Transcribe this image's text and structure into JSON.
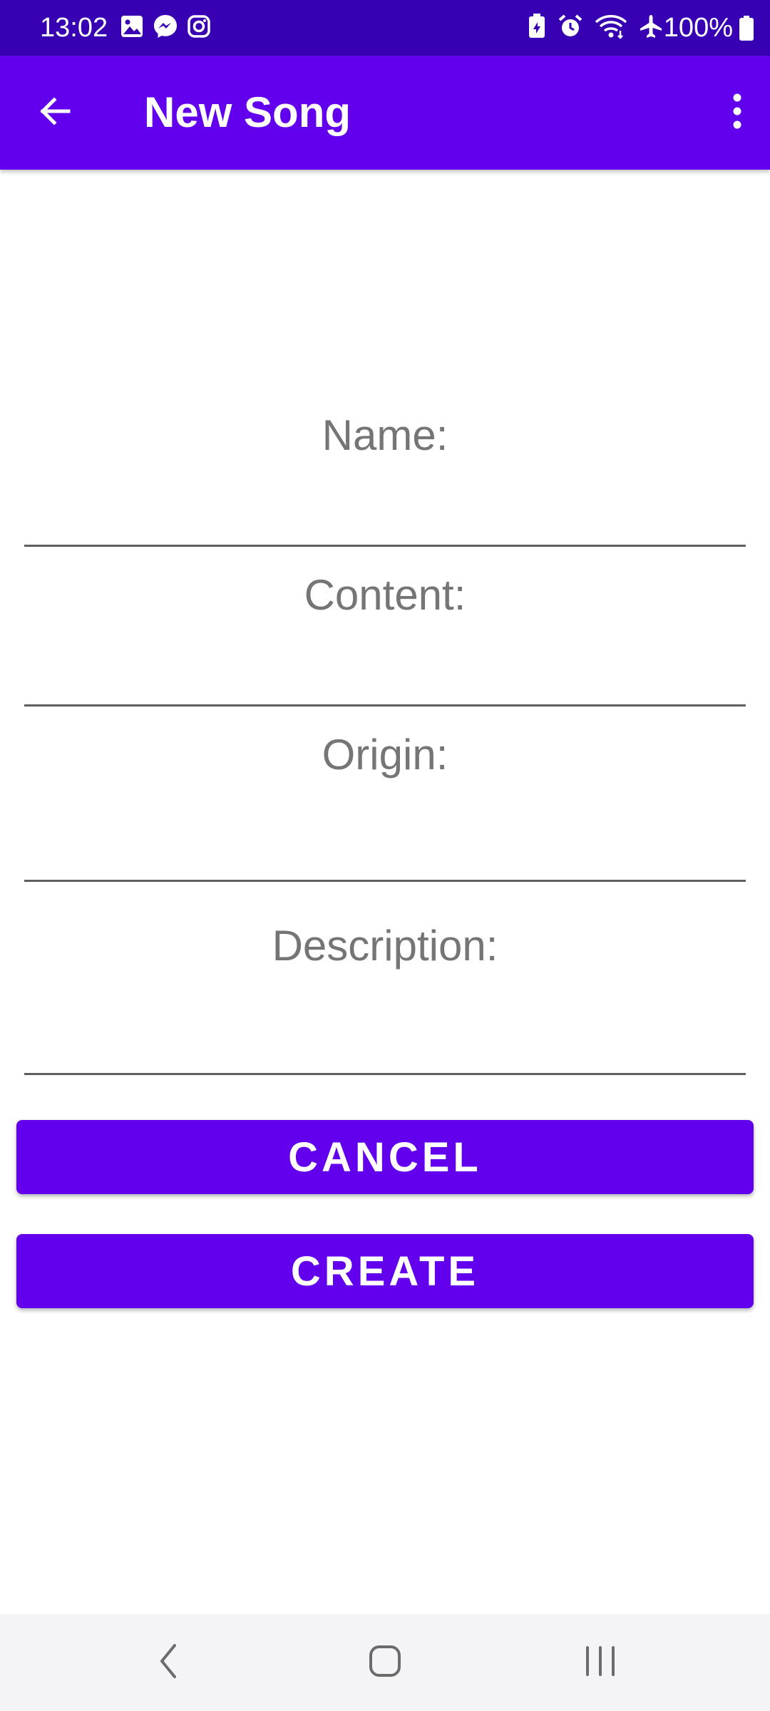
{
  "status_bar": {
    "time": "13:02",
    "battery_text": "100%",
    "left_icons": [
      "gallery-icon",
      "messenger-icon",
      "instagram-icon"
    ],
    "right_icons": [
      "battery-saver-icon",
      "alarm-icon",
      "wifi-icon",
      "airplane-mode-icon",
      "battery-icon"
    ]
  },
  "app_bar": {
    "title": "New Song",
    "back_icon": "arrow-back-icon",
    "menu_icon": "more-vert-icon"
  },
  "form": {
    "name_label": "Name:",
    "name_value": "",
    "content_label": "Content:",
    "content_value": "",
    "origin_label": "Origin:",
    "origin_value": "",
    "description_label": "Description:",
    "description_value": ""
  },
  "buttons": {
    "cancel_label": "CANCEL",
    "create_label": "CREATE"
  },
  "nav_bar": {
    "icons": [
      "back-icon",
      "home-icon",
      "recents-icon"
    ]
  },
  "colors": {
    "status_bar": "#3700b3",
    "primary": "#6200ee",
    "label_text": "#757575",
    "nav_background": "#f4f4f6"
  }
}
